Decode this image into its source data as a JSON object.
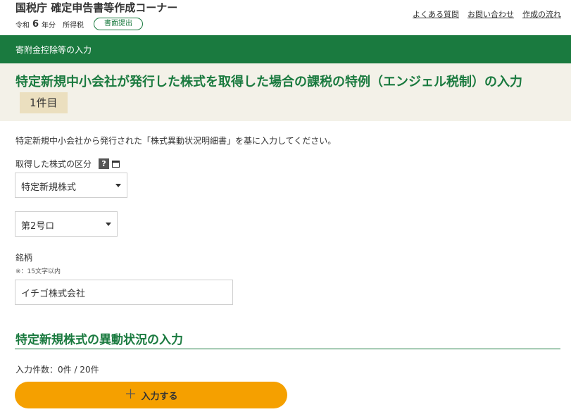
{
  "header": {
    "site_title": "国税庁 確定申告書等作成コーナー",
    "era": "令和",
    "year": "6",
    "year_suffix": "年分",
    "tax_type": "所得税",
    "badge": "書面提出",
    "links": [
      "よくある質問",
      "お問い合わせ",
      "作成の流れ"
    ]
  },
  "section_bar": {
    "label": "寄附金控除等の入力"
  },
  "page": {
    "title": "特定新規中小会社が発行した株式を取得した場合の課税の特例（エンジェル税制）の入力",
    "count_tag": "1件目",
    "instruction": "特定新規中小会社から発行された「株式異動状況明細書」を基に入力してください。"
  },
  "form": {
    "stock_type_label": "取得した株式の区分",
    "help_icon": "?",
    "stock_type_value": "特定新規株式",
    "sub_type_value": "第2号ロ",
    "name_label": "銘柄",
    "name_note": "※：15文字以内",
    "name_value": "イチゴ株式会社"
  },
  "movement": {
    "title": "特定新規株式の異動状況の入力",
    "count_text": "入力件数：0件 / 20件",
    "add_button_icon": "＋",
    "add_button_label": "入力する"
  },
  "colors": {
    "brand_green": "#1a7a3f",
    "title_band": "#f3f1e8",
    "count_tag_bg": "#ebdfbf",
    "accent_orange": "#f5a000"
  }
}
